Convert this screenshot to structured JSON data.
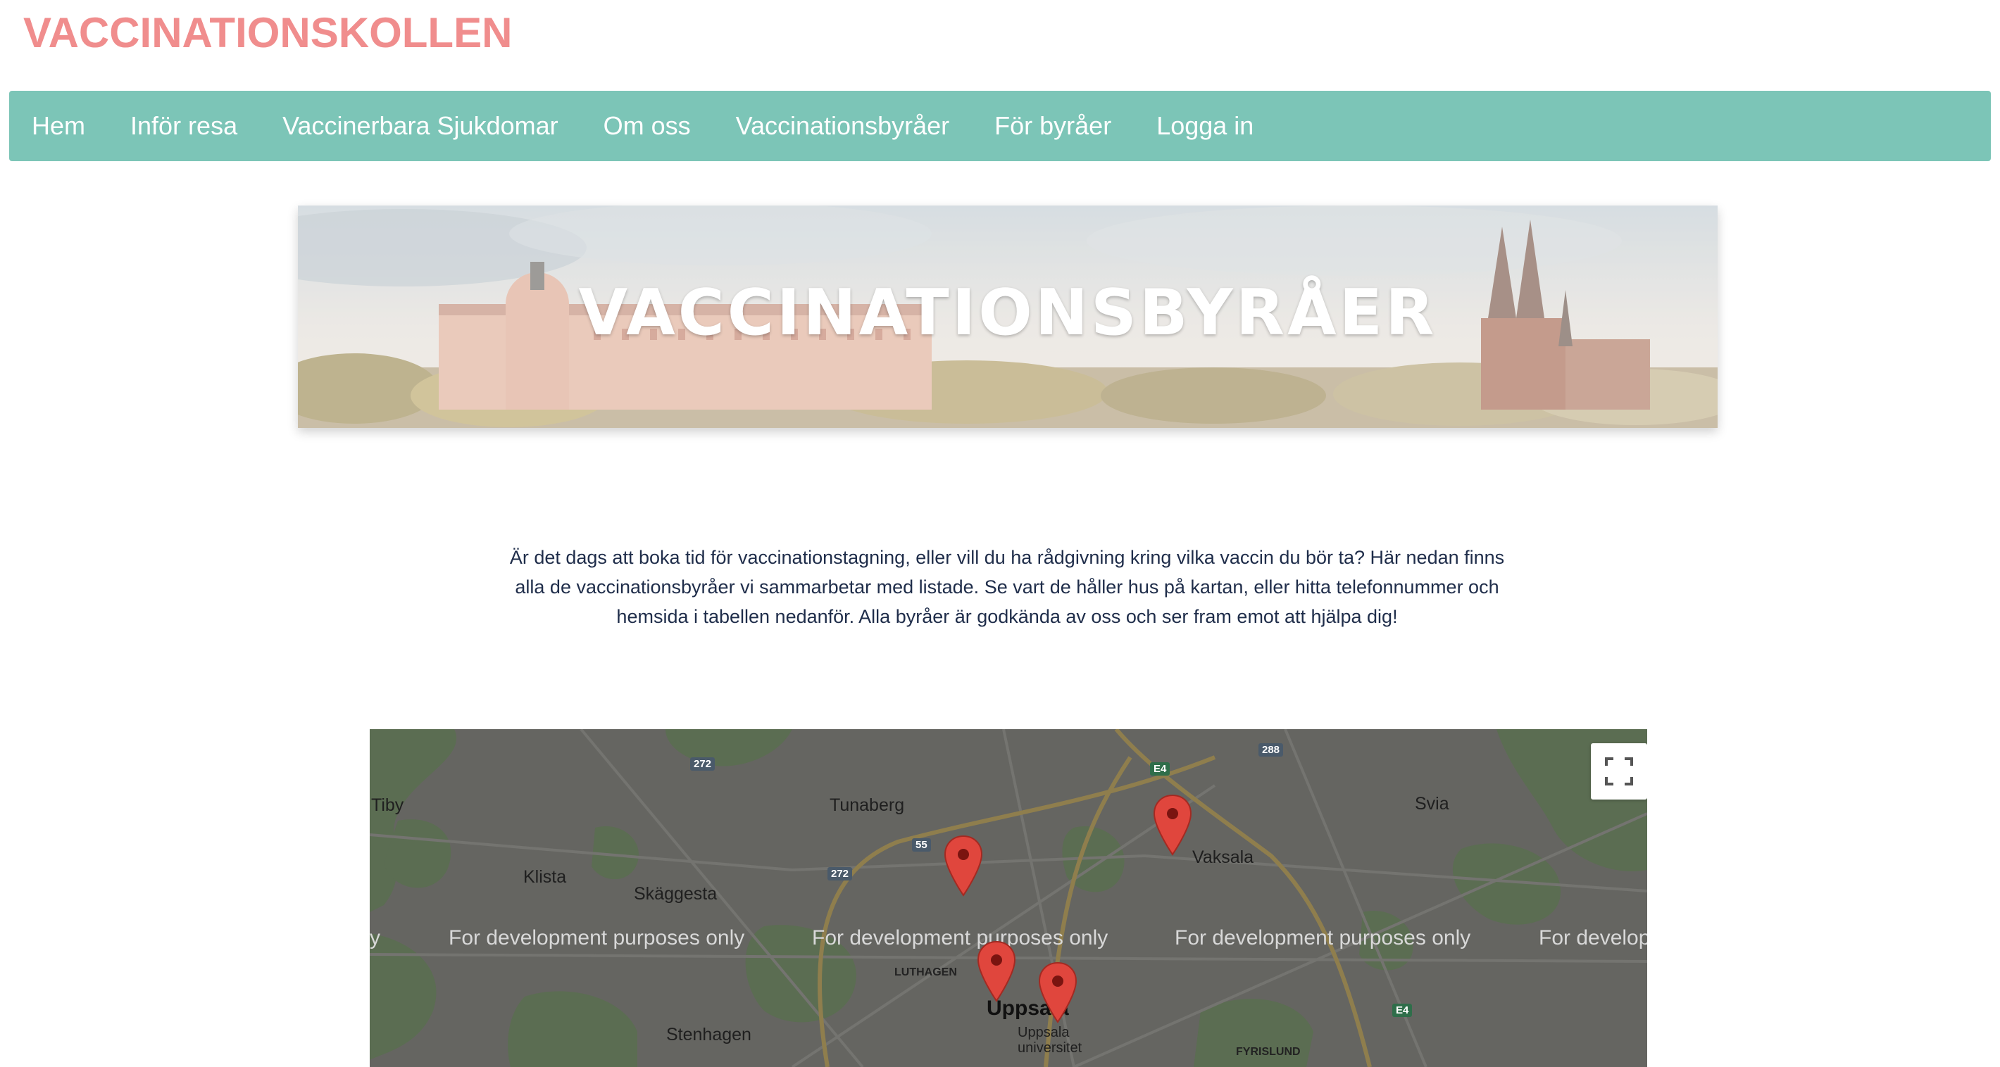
{
  "site": {
    "title": "VACCINATIONSKOLLEN"
  },
  "nav": {
    "items": [
      {
        "label": "Hem"
      },
      {
        "label": "Inför resa"
      },
      {
        "label": "Vaccinerbara Sjukdomar"
      },
      {
        "label": "Om oss"
      },
      {
        "label": "Vaccinationsbyråer"
      },
      {
        "label": "För byråer"
      },
      {
        "label": "Logga in"
      }
    ]
  },
  "banner": {
    "title": "VACCINATIONSBYRÅER"
  },
  "intro": {
    "text": "Är det dags att boka tid för vaccinationstagning, eller vill du ha rådgivning kring vilka vaccin du bör ta? Här nedan finns alla de vaccinationsbyråer vi sammarbetar med listade. Se vart de håller hus på kartan, eller hitta telefonnummer och hemsida i tabellen nedanför. Alla byråer är godkända av oss och ser fram emot att hjälpa dig!"
  },
  "map": {
    "places": {
      "tiby": "Tiby",
      "tunaberg": "Tunaberg",
      "svia": "Svia",
      "vaksala": "Vaksala",
      "klista": "Klista",
      "skaggesta": "Skäggesta",
      "luthagen": "LUTHAGEN",
      "uppsala": "Uppsala",
      "uppsala_universitet": "Uppsala universitet",
      "stenhagen": "Stenhagen",
      "fyrislund": "FYRISLUND"
    },
    "roads": {
      "r272a": "272",
      "r272b": "272",
      "r288": "288",
      "r55": "55",
      "e4a": "E4",
      "e4b": "E4"
    },
    "dev_watermark": {
      "w1": "y",
      "w2": "For development purposes only",
      "w3": "For development purposes only",
      "w4": "For development purposes only",
      "w5": "For develop"
    },
    "marker_icon": "map-pin-icon",
    "fullscreen_icon": "fullscreen-icon"
  }
}
